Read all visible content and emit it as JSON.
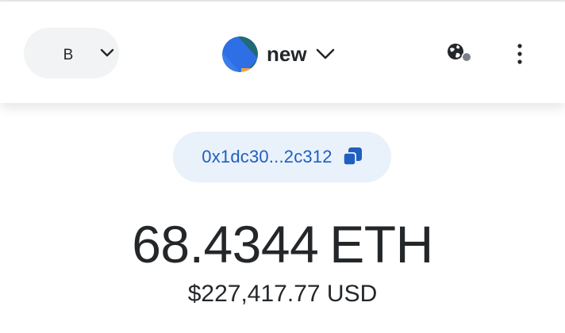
{
  "network": {
    "letter": "B"
  },
  "account": {
    "name": "new"
  },
  "address": {
    "short": "0x1dc30...2c312"
  },
  "balance": {
    "amount": "68.4344",
    "unit": "ETH",
    "fiat": "$227,417.77 USD"
  },
  "colors": {
    "accent_blue": "#1f5fbf",
    "address_pill_bg": "#e9f1fb",
    "network_pill_bg": "#f2f3f4",
    "text_primary": "#24272a"
  },
  "icons": {
    "network_chevron": "chevron-down-icon",
    "account_chevron": "chevron-down-icon",
    "globe": "globe-icon",
    "menu": "kebab-menu-icon",
    "copy": "copy-icon"
  }
}
